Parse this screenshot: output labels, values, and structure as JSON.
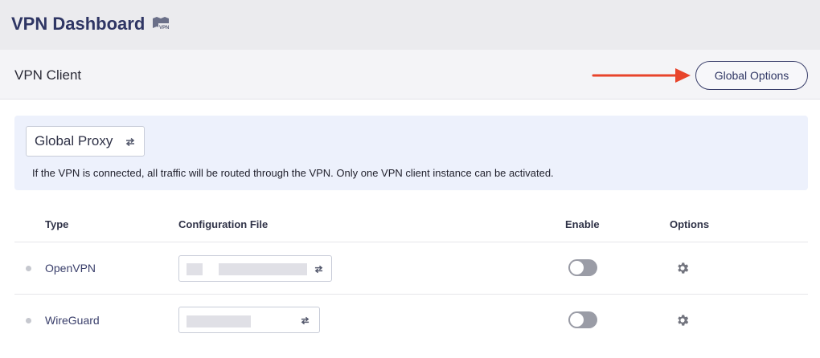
{
  "header": {
    "title": "VPN Dashboard",
    "title_icon": "vpn-icon"
  },
  "subheader": {
    "title": "VPN Client",
    "global_options_label": "Global Options"
  },
  "info_panel": {
    "mode_value": "Global Proxy",
    "description": "If the VPN is connected, all traffic will be routed through the VPN. Only one VPN client instance can be activated."
  },
  "table": {
    "columns": [
      "Type",
      "Configuration File",
      "Enable",
      "Options"
    ],
    "rows": [
      {
        "type": "OpenVPN",
        "config_file": "",
        "enabled": false,
        "options_icon": "gear-icon"
      },
      {
        "type": "WireGuard",
        "config_file": "",
        "enabled": false,
        "options_icon": "gear-icon"
      }
    ]
  },
  "colors": {
    "accent": "#2f3664",
    "arrow": "#e8442b",
    "panel_bg": "#edf1fc",
    "toggle_off": "#9a9ca6"
  }
}
